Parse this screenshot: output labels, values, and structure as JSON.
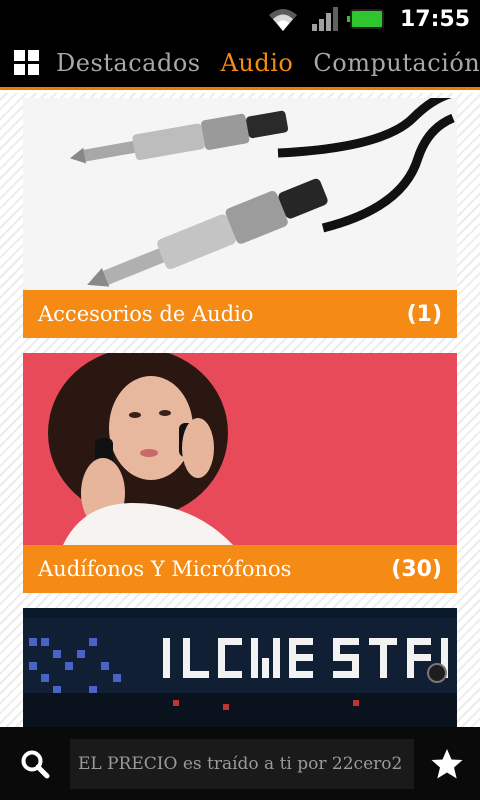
{
  "status_bar": {
    "time": "17:55",
    "icons": [
      "wifi-icon",
      "signal-icon",
      "battery-icon"
    ],
    "battery_color": "#2ec52e"
  },
  "tabs": [
    {
      "label": "Destacados",
      "active": false
    },
    {
      "label": "Audio",
      "active": true
    },
    {
      "label": "Computación",
      "active": false
    }
  ],
  "colors": {
    "accent": "#f58a14",
    "tab_inactive": "#a8a8a8",
    "bar_bg": "#000000"
  },
  "categories": [
    {
      "title": "Accesorios de Audio",
      "count": "(1)",
      "image": "audio-jack-cables-image"
    },
    {
      "title": "Audífonos Y Micrófonos",
      "count": "(30)",
      "image": "woman-with-headphones-image"
    },
    {
      "title": "",
      "count": "",
      "image": "led-display-image"
    }
  ],
  "bottom_bar": {
    "marquee": "EL PRECIO es traído a ti por 22cero2",
    "left_icon": "search-icon",
    "right_icon": "star-icon"
  }
}
